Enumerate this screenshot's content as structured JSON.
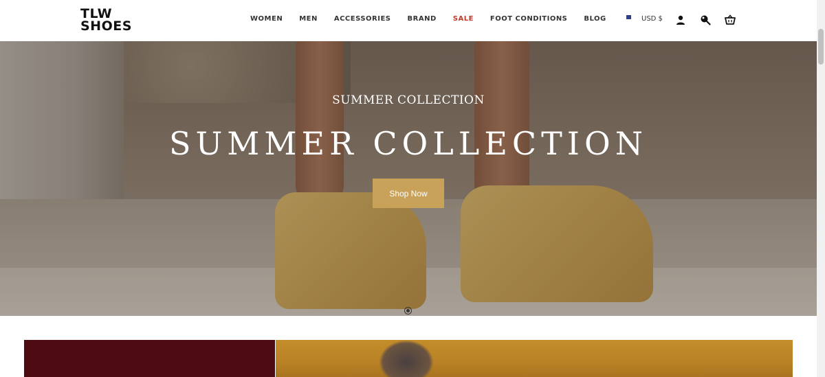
{
  "header": {
    "logo_line1": "TLW",
    "logo_line2": "SHOES",
    "nav": [
      {
        "label": "WOMEN"
      },
      {
        "label": "MEN"
      },
      {
        "label": "ACCESSORIES"
      },
      {
        "label": "BRAND"
      },
      {
        "label": "SALE"
      },
      {
        "label": "FOOT CONDITIONS"
      },
      {
        "label": "BLOG"
      }
    ],
    "currency": "USD $",
    "icons": [
      "user-icon",
      "search-icon",
      "cart-icon"
    ]
  },
  "hero": {
    "subtitle": "SUMMER COLLECTION",
    "title": "SUMMER COLLECTION",
    "button_label": "Shop Now",
    "button_color": "#c9a25a",
    "slide_count": 1,
    "active_slide": 1
  },
  "colors": {
    "sale": "#c0392b",
    "banner_left": "#4e0c12",
    "banner_right": "#c48d2a"
  }
}
